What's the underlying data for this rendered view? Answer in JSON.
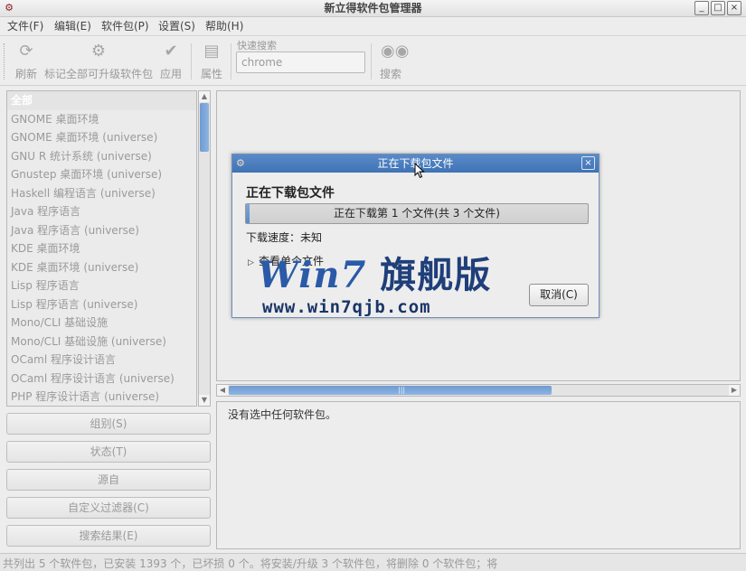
{
  "window": {
    "title": "新立得软件包管理器",
    "controls": {
      "minimize": "_",
      "maximize": "□",
      "close": "×"
    }
  },
  "menubar": [
    {
      "label": "文件(F)"
    },
    {
      "label": "编辑(E)"
    },
    {
      "label": "软件包(P)"
    },
    {
      "label": "设置(S)"
    },
    {
      "label": "帮助(H)"
    }
  ],
  "toolbar": {
    "reload": "刷新",
    "mark_all_upgrades": "标记全部可升级软件包",
    "apply": "应用",
    "properties": "属性",
    "quick_search_label": "快速搜索",
    "quick_search_value": "chrome",
    "search": "搜索",
    "icons": {
      "reload": "refresh-icon",
      "mark_all_upgrades": "upgrade-icon",
      "apply": "checkmark-icon",
      "properties": "properties-icon",
      "search": "binoculars-icon"
    }
  },
  "categories": [
    "全部",
    "GNOME 桌面环境",
    "GNOME 桌面环境 (universe)",
    "GNU R 统计系统 (universe)",
    "Gnustep 桌面环境 (universe)",
    "Haskell 编程语言 (universe)",
    "Java 程序语言",
    "Java 程序语言 (universe)",
    "KDE 桌面环境",
    "KDE 桌面环境 (universe)",
    "Lisp 程序语言",
    "Lisp 程序语言 (universe)",
    "Mono/CLI 基础设施",
    "Mono/CLI 基础设施 (universe)",
    "OCaml 程序设计语言",
    "OCaml 程序设计语言 (universe)",
    "PHP 程序设计语言 (universe)"
  ],
  "side_buttons": {
    "sections": "组别(S)",
    "status": "状态(T)",
    "origin": "源自",
    "custom_filters": "自定义过滤器(C)",
    "search_results": "搜索结果(E)"
  },
  "detail": {
    "text": "没有选中任何软件包。"
  },
  "status_bar": {
    "text": "共列出 5 个软件包，已安装 1393 个，已坏损 0 个。将安装/升级 3 个软件包，将删除 0 个软件包；将"
  },
  "dialog": {
    "title": "正在下载包文件",
    "heading": "正在下载包文件",
    "progress_text": "正在下载第 1 个文件(共 3 个文件)",
    "progress_fraction": 0.01,
    "speed": "下载速度：未知",
    "expander": "查看单个文件",
    "cancel": "取消(C)",
    "close": "×"
  },
  "watermark": {
    "brand_latin": "Win7",
    "brand_cn": "旗舰版",
    "url": "www.win7qjb.com"
  },
  "colors": {
    "accent": "#5a8ac8",
    "watermark_blue": "#2a5aa8"
  }
}
